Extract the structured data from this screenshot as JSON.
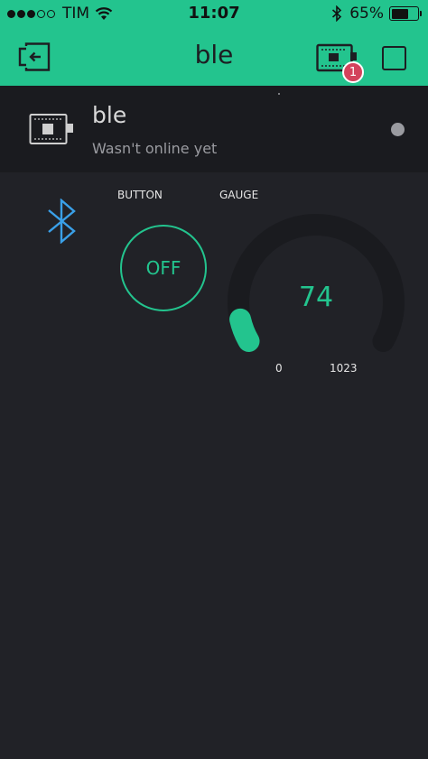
{
  "status_bar": {
    "carrier": "TIM",
    "time": "11:07",
    "battery_percent": "65%",
    "battery_level": 0.65
  },
  "header": {
    "title": "ble",
    "notification_count": "1"
  },
  "device": {
    "name": "ble",
    "status": "Wasn't online yet"
  },
  "widgets": {
    "button": {
      "label": "BUTTON",
      "state": "OFF"
    },
    "gauge": {
      "label": "GAUGE",
      "value": "74",
      "min": "0",
      "max": "1023"
    }
  },
  "colors": {
    "accent": "#23c48e",
    "background": "#212227",
    "badge": "#d3435c",
    "bluetooth": "#3aa0e8"
  }
}
